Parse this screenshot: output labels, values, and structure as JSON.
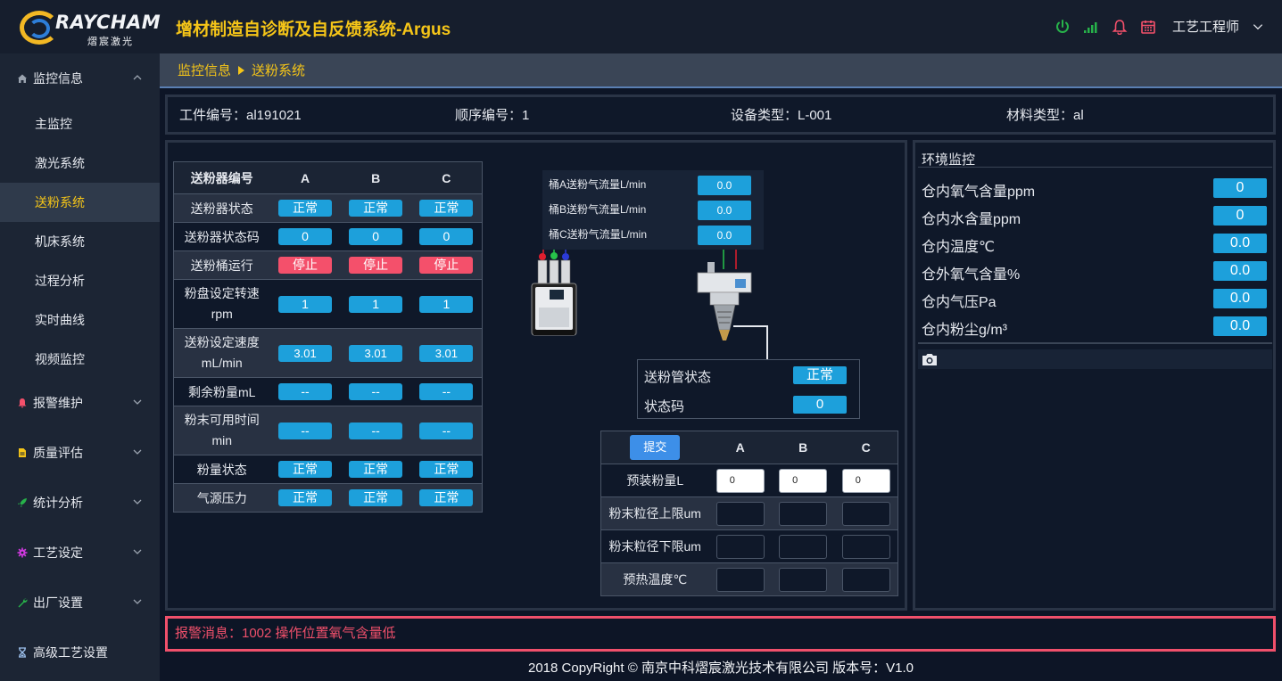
{
  "header": {
    "logo_text": "RAYCHAM",
    "logo_sub": "熠宸激光",
    "app_title": "增材制造自诊断及自反馈系统-Argus",
    "user": "工艺工程师",
    "colors": {
      "accent": "#f5c518",
      "status_blue": "#1da0db",
      "status_red": "#f4506b"
    }
  },
  "sidebar": {
    "groups": [
      {
        "label": "监控信息",
        "icon": "home-icon"
      },
      {
        "label": "报警维护",
        "icon": "bell-icon"
      },
      {
        "label": "质量评估",
        "icon": "document-icon"
      },
      {
        "label": "统计分析",
        "icon": "rocket-icon"
      },
      {
        "label": "工艺设定",
        "icon": "gear-icon"
      },
      {
        "label": "出厂设置",
        "icon": "wrench-icon"
      },
      {
        "label": "高级工艺设置",
        "icon": "hourglass-icon"
      }
    ],
    "items": [
      {
        "label": "主监控"
      },
      {
        "label": "激光系统"
      },
      {
        "label": "送粉系统"
      },
      {
        "label": "机床系统"
      },
      {
        "label": "过程分析"
      },
      {
        "label": "实时曲线"
      },
      {
        "label": "视频监控"
      }
    ]
  },
  "breadcrumb": {
    "parent": "监控信息",
    "current": "送粉系统"
  },
  "info": {
    "part_no": "工件编号：al191021",
    "seq_no": "顺序编号：1",
    "device_type": "设备类型：L-001",
    "material_type": "材料类型：al"
  },
  "feeder": {
    "header": "送粉器编号",
    "cols": [
      "A",
      "B",
      "C"
    ],
    "rows": [
      {
        "label": "送粉器状态",
        "values": [
          "正常",
          "正常",
          "正常"
        ],
        "status": "blue"
      },
      {
        "label": "送粉器状态码",
        "values": [
          "0",
          "0",
          "0"
        ],
        "status": "blue"
      },
      {
        "label": "送粉桶运行",
        "values": [
          "停止",
          "停止",
          "停止"
        ],
        "status": "red"
      },
      {
        "label": "粉盘设定转速rpm",
        "values": [
          "1",
          "1",
          "1"
        ],
        "status": "blue"
      },
      {
        "label": "送粉设定速度mL/min",
        "values": [
          "3.01",
          "3.01",
          "3.01"
        ],
        "status": "blue"
      },
      {
        "label": "剩余粉量mL",
        "values": [
          "--",
          "--",
          "--"
        ],
        "status": "blue"
      },
      {
        "label": "粉末可用时间min",
        "values": [
          "--",
          "--",
          "--"
        ],
        "status": "blue"
      },
      {
        "label": "粉量状态",
        "values": [
          "正常",
          "正常",
          "正常"
        ],
        "status": "blue"
      },
      {
        "label": "气源压力",
        "values": [
          "正常",
          "正常",
          "正常"
        ],
        "status": "blue"
      }
    ]
  },
  "gas_flow": [
    {
      "label": "桶A送粉气流量L/min",
      "value": "0.0"
    },
    {
      "label": "桶B送粉气流量L/min",
      "value": "0.0"
    },
    {
      "label": "桶C送粉气流量L/min",
      "value": "0.0"
    }
  ],
  "tube": [
    {
      "label": "送粉管状态",
      "value": "正常"
    },
    {
      "label": "状态码",
      "value": "0"
    }
  ],
  "params": {
    "submit_label": "提交",
    "cols": [
      "A",
      "B",
      "C"
    ],
    "rows": [
      {
        "label": "预装粉量L",
        "values": [
          "0",
          "0",
          "0"
        ]
      },
      {
        "label": "粉末粒径上限um",
        "values": [
          "",
          "",
          ""
        ]
      },
      {
        "label": "粉末粒径下限um",
        "values": [
          "",
          "",
          ""
        ]
      },
      {
        "label": "预热温度℃",
        "values": [
          "",
          "",
          ""
        ]
      }
    ]
  },
  "env": {
    "title": "环境监控",
    "rows": [
      {
        "label": "仓内氧气含量ppm",
        "value": "0"
      },
      {
        "label": "仓内水含量ppm",
        "value": "0"
      },
      {
        "label": "仓内温度℃",
        "value": "0.0"
      },
      {
        "label": "仓外氧气含量%",
        "value": "0.0"
      },
      {
        "label": "仓内气压Pa",
        "value": "0.0"
      },
      {
        "label": "仓内粉尘g/m³",
        "value": "0.0"
      }
    ]
  },
  "alarm": {
    "text": "报警消息：1002 操作位置氧气含量低"
  },
  "footer": {
    "text": "2018 CopyRight © 南京中科熠宸激光技术有限公司 版本号：V1.0"
  }
}
